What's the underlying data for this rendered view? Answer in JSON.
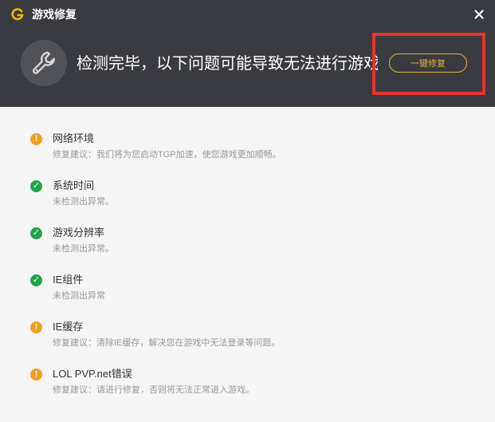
{
  "window": {
    "title": "游戏修复",
    "close_icon": "close-icon",
    "logo_icon": "tgp-logo-icon"
  },
  "header": {
    "icon": "wrench-icon",
    "headline": "检测完毕，以下问题可能导致无法进行游戏",
    "fix_button": "一键修复",
    "accent_color": "#e3b23c",
    "highlight_color": "#e8332c"
  },
  "items": [
    {
      "status": "warning",
      "icon": "warning-icon",
      "title": "网络环境",
      "desc": "修复建议：我们将为您启动TGP加速，使您游戏更加顺畅。"
    },
    {
      "status": "ok",
      "icon": "check-icon",
      "title": "系统时间",
      "desc": "未检测出异常。"
    },
    {
      "status": "ok",
      "icon": "check-icon",
      "title": "游戏分辨率",
      "desc": "未检测出异常。"
    },
    {
      "status": "ok",
      "icon": "check-icon",
      "title": "IE组件",
      "desc": "未检测出异常"
    },
    {
      "status": "warning",
      "icon": "warning-icon",
      "title": "IE缓存",
      "desc": "修复建议：清除IE缓存，解决您在游戏中无法登录等问题。"
    },
    {
      "status": "warning",
      "icon": "warning-icon",
      "title": "LOL PVP.net错误",
      "desc": "修复建议：请进行修复，否则将无法正常进入游戏。"
    }
  ],
  "colors": {
    "warning": "#f59d1d",
    "ok": "#1fa64a"
  }
}
